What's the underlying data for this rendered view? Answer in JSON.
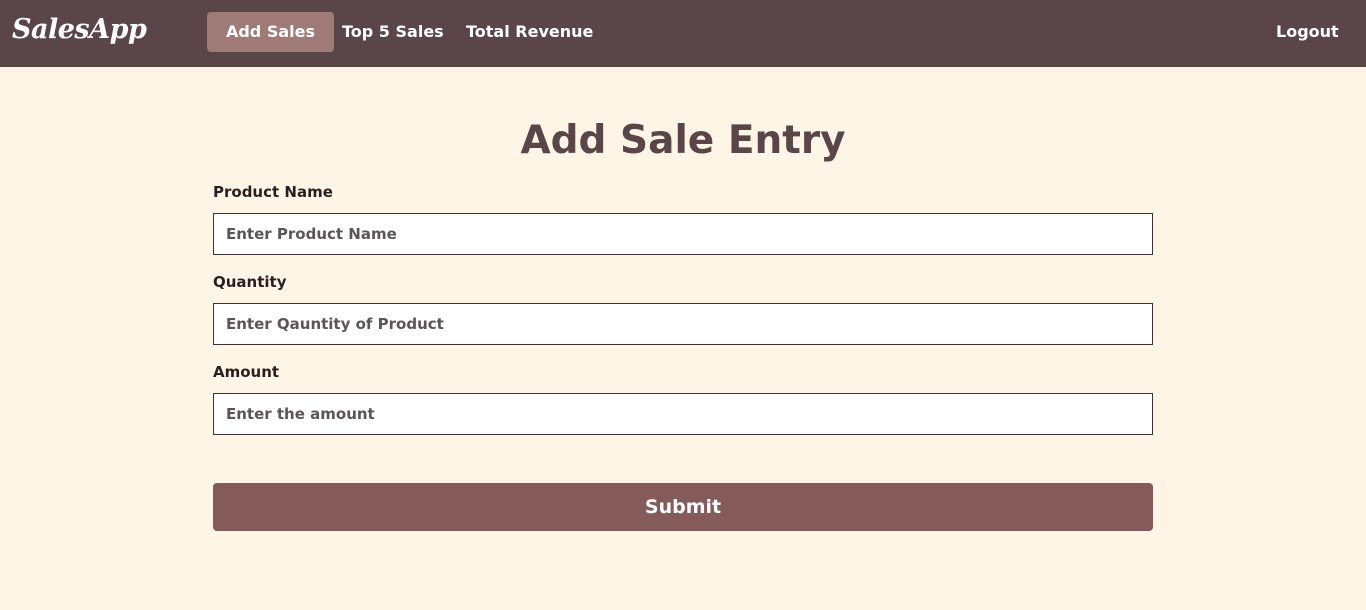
{
  "navbar": {
    "brand": "SalesApp",
    "links": [
      {
        "label": "Add Sales",
        "active": true
      },
      {
        "label": "Top 5 Sales",
        "active": false
      },
      {
        "label": "Total Revenue",
        "active": false
      }
    ],
    "logout_label": "Logout"
  },
  "form": {
    "title": "Add Sale Entry",
    "fields": [
      {
        "label": "Product Name",
        "placeholder": "Enter Product Name",
        "value": ""
      },
      {
        "label": "Quantity",
        "placeholder": "Enter Qauntity of Product",
        "value": ""
      },
      {
        "label": "Amount",
        "placeholder": "Enter the amount",
        "value": ""
      }
    ],
    "submit_label": "Submit"
  },
  "colors": {
    "navbar_bg": "#5A4649",
    "active_link_bg": "#A07A77",
    "page_bg": "#FFF5E7",
    "title_text": "#5A4649",
    "submit_bg": "#845A5B"
  }
}
